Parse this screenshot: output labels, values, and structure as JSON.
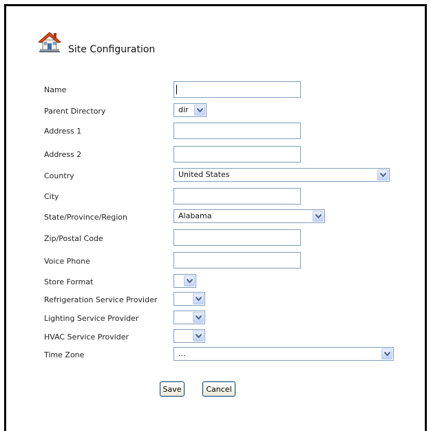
{
  "page": {
    "title": "Site Configuration"
  },
  "form": {
    "name": {
      "label": "Name",
      "value": ""
    },
    "parent_directory": {
      "label": "Parent Directory",
      "selected": "dir"
    },
    "address1": {
      "label": "Address 1",
      "value": ""
    },
    "address2": {
      "label": "Address 2",
      "value": ""
    },
    "country": {
      "label": "Country",
      "selected": "United States"
    },
    "city": {
      "label": "City",
      "value": ""
    },
    "state": {
      "label": "State/Province/Region",
      "selected": "Alabama"
    },
    "zip": {
      "label": "Zip/Postal Code",
      "value": ""
    },
    "voice_phone": {
      "label": "Voice Phone",
      "value": ""
    },
    "store_format": {
      "label": "Store Format",
      "selected": ""
    },
    "refrigeration": {
      "label": "Refrigeration Service Provider",
      "selected": ""
    },
    "lighting": {
      "label": "Lighting Service Provider",
      "selected": ""
    },
    "hvac": {
      "label": "HVAC Service Provider",
      "selected": ""
    },
    "time_zone": {
      "label": "Time Zone",
      "selected": "..."
    }
  },
  "buttons": {
    "save": "Save",
    "cancel": "Cancel"
  },
  "icons": {
    "header": "house-icon",
    "dropdown": "chevron-down-icon"
  },
  "colors": {
    "input_border": "#7f9db9",
    "dropdown_button": "#c1d3fb",
    "button_border": "#003c74"
  }
}
